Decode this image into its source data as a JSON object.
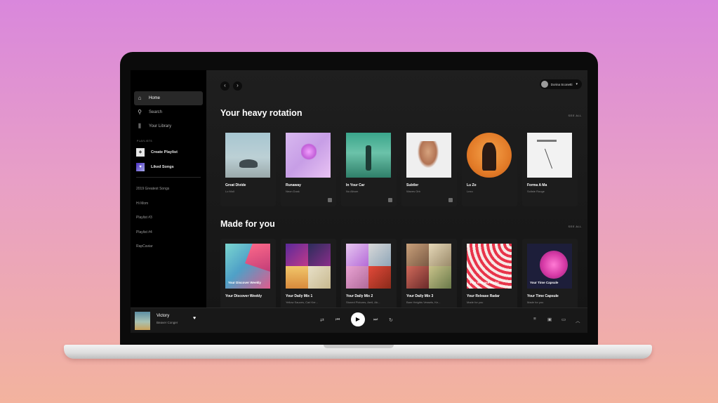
{
  "sidebar": {
    "nav": [
      {
        "label": "Home",
        "icon": "home-icon"
      },
      {
        "label": "Search",
        "icon": "search-icon"
      },
      {
        "label": "Your Library",
        "icon": "library-icon"
      }
    ],
    "playlists_heading": "PLAYLISTS",
    "create_playlist": "Create Playlist",
    "liked_songs": "Liked Songs",
    "playlists": [
      "2019 Greatest Songs",
      "Hi Mom",
      "Playlist #3",
      "Playlist #4",
      "RapCaviar"
    ]
  },
  "topbar": {
    "back_icon": "‹",
    "forward_icon": "›",
    "user_name": "Dorina Sconetti",
    "caret": "▾"
  },
  "rotation": {
    "title": "Your heavy rotation",
    "see_all": "SEE ALL",
    "cards": [
      {
        "title": "Great Divide",
        "subtitle": "Lo Moll"
      },
      {
        "title": "Runaway",
        "subtitle": "Neon Dusk"
      },
      {
        "title": "In Your Car",
        "subtitle": "No Album"
      },
      {
        "title": "Subtler",
        "subtitle": "Waves Orb"
      },
      {
        "title": "Lu Zo",
        "subtitle": "Lezo"
      },
      {
        "title": "Forma A Ma",
        "subtitle": "Soliste Rouge"
      }
    ]
  },
  "made_for_you": {
    "title": "Made for you",
    "see_all": "SEE ALL",
    "cards": [
      {
        "title": "Your Discover Weekly",
        "subtitle": "",
        "art_label": "Your Discover Weekly"
      },
      {
        "title": "Your Daily Mix 1",
        "subtitle": "Yellow Sauces, Carl Ker...",
        "art_label": ""
      },
      {
        "title": "Your Daily Mix 2",
        "subtitle": "Stoned Pictures, Aeril, Ab...",
        "art_label": ""
      },
      {
        "title": "Your Daily Mix 3",
        "subtitle": "Bare Heights Vessels, Ke...",
        "art_label": ""
      },
      {
        "title": "Your Release Radar",
        "subtitle": "Made for you",
        "art_label": "Your Release Radar"
      },
      {
        "title": "Your Time Capsule",
        "subtitle": "Made for you",
        "art_label": "Your Time Capsule"
      }
    ]
  },
  "player": {
    "track": "Victory",
    "artist": "Beaver Conger",
    "heart": "♥",
    "shuffle": "⇄",
    "prev": "⏮",
    "play": "▶",
    "next": "⏭",
    "repeat": "↻",
    "queue": "≡",
    "devices": "▣",
    "volume": "▭",
    "expand": "︿"
  }
}
